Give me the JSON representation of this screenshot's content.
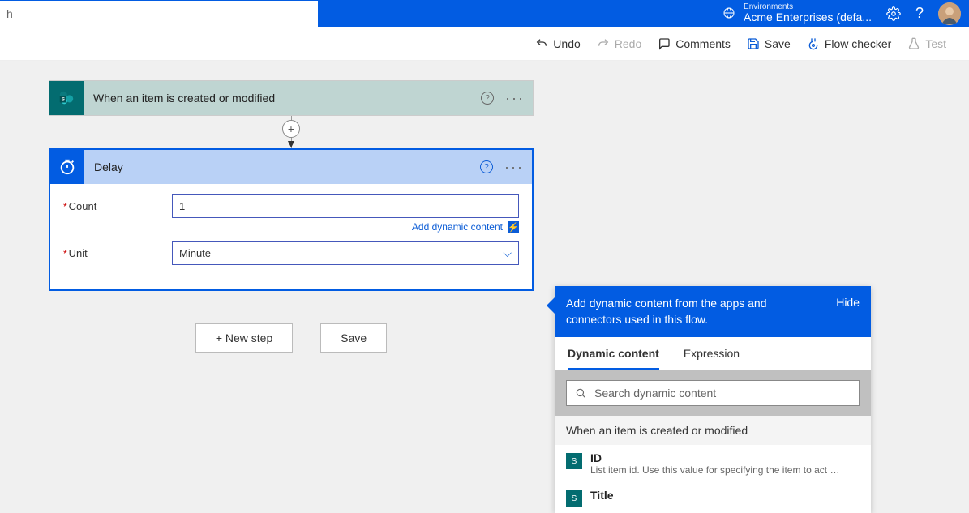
{
  "header": {
    "search_value": "h",
    "env_label": "Environments",
    "env_name": "Acme Enterprises (defa..."
  },
  "toolbar": {
    "undo": "Undo",
    "redo": "Redo",
    "comments": "Comments",
    "save": "Save",
    "flow_checker": "Flow checker",
    "test": "Test"
  },
  "trigger": {
    "title": "When an item is created or modified"
  },
  "action": {
    "title": "Delay",
    "fields": {
      "count_label": "Count",
      "count_value": "1",
      "unit_label": "Unit",
      "unit_value": "Minute"
    },
    "add_dynamic_link": "Add dynamic content"
  },
  "buttons": {
    "new_step": "+ New step",
    "save": "Save"
  },
  "flyout": {
    "header_text": "Add dynamic content from the apps and connectors used in this flow.",
    "hide": "Hide",
    "tabs": {
      "dynamic": "Dynamic content",
      "expression": "Expression"
    },
    "search_placeholder": "Search dynamic content",
    "group_title": "When an item is created or modified",
    "items": [
      {
        "title": "ID",
        "desc": "List item id. Use this value for specifying the item to act o..."
      },
      {
        "title": "Title",
        "desc": ""
      }
    ]
  }
}
